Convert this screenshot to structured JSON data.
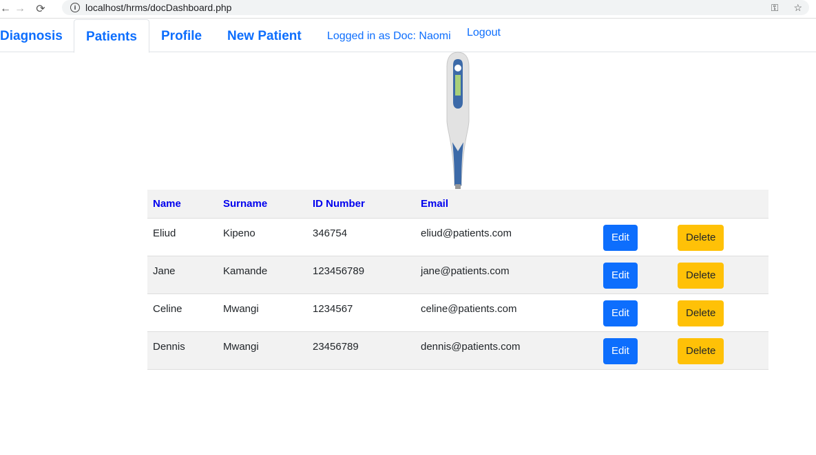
{
  "browser": {
    "url": "localhost/hrms/docDashboard.php"
  },
  "nav": {
    "tabs": [
      "Diagnosis",
      "Patients",
      "Profile",
      "New Patient"
    ],
    "logged_in": "Logged in as Doc: Naomi",
    "logout": "Logout"
  },
  "table": {
    "headers": [
      "Name",
      "Surname",
      "ID Number",
      "Email"
    ],
    "rows": [
      {
        "name": "Eliud",
        "surname": "Kipeno",
        "id": "346754",
        "email": "eliud@patients.com"
      },
      {
        "name": "Jane",
        "surname": "Kamande",
        "id": "123456789",
        "email": "jane@patients.com"
      },
      {
        "name": "Celine",
        "surname": "Mwangi",
        "id": "1234567",
        "email": "celine@patients.com"
      },
      {
        "name": "Dennis",
        "surname": "Mwangi",
        "id": "23456789",
        "email": "dennis@patients.com"
      }
    ],
    "edit_label": "Edit",
    "delete_label": "Delete"
  },
  "colors": {
    "primary": "#0d6efd",
    "warning": "#ffc107",
    "header_text": "#0000ee"
  }
}
